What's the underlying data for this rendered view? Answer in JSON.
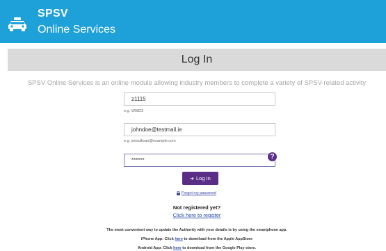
{
  "header": {
    "title": "SPSV",
    "subtitle": "Online Services",
    "logo_icon": "taxi-icon",
    "color": "#1ea0d8"
  },
  "page": {
    "heading": "Log In",
    "intro": "SPSV Online Services is an online module allowing industry members to complete a variety of SPSV-related activity"
  },
  "form": {
    "licence": {
      "value": "z1115",
      "hint": "e.g. W9823"
    },
    "email": {
      "value": "johndoe@testmail.ie",
      "hint": "e.g. joesullivan@example.com"
    },
    "password": {
      "value": "******",
      "help_icon": "question-mark-icon"
    },
    "submit_label": "Log In",
    "submit_icon": "sign-in-icon",
    "submit_color": "#5a2d86",
    "forgot_label": "Forgot my password"
  },
  "register": {
    "prompt": "Not registered yet?",
    "link": "Click here to register"
  },
  "footer": {
    "line1": "The most convenient way to update the Authority with your details is by using the smartphone app.",
    "iphone_prefix": "iPhone App: Click",
    "iphone_link": "here",
    "iphone_suffix": "to download from the Apple AppStore",
    "android_prefix": "Android App: Click",
    "android_link": "here",
    "android_suffix": "to download from the Google Play store."
  }
}
